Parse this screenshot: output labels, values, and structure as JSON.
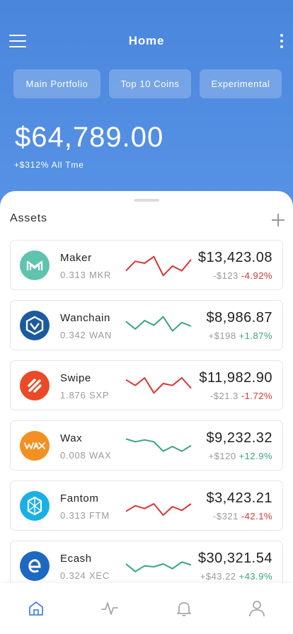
{
  "header": {
    "title": "Home"
  },
  "tabs": [
    {
      "label": "Main Portfolio"
    },
    {
      "label": "Top 10 Coins"
    },
    {
      "label": "Experimental"
    }
  ],
  "portfolio": {
    "balance": "$64,789.00",
    "change": "+$312% All Tme"
  },
  "assets": {
    "title": "Assets",
    "items": [
      {
        "name": "Maker",
        "amount": "0.313 MKR",
        "price": "$13,423.08",
        "change_usd": "-$123",
        "change_pct": "-4.92%",
        "trend": "negative",
        "logo_color": "#5fc3ad",
        "logo_icon": "maker-logo-icon",
        "spark": [
          30,
          40,
          38,
          45,
          25,
          35,
          30,
          42
        ]
      },
      {
        "name": "Wanchain",
        "amount": "0.342 WAN",
        "price": "$8,986.87",
        "change_usd": "+$198",
        "change_pct": "+1.87%",
        "trend": "positive",
        "logo_color": "#1c5aa0",
        "logo_icon": "wanchain-logo-icon",
        "spark": [
          40,
          32,
          41,
          36,
          45,
          30,
          39,
          35
        ]
      },
      {
        "name": "Swipe",
        "amount": "1.876 SXP",
        "price": "$11,982.90",
        "change_usd": "-$21.3",
        "change_pct": "-1.72%",
        "trend": "negative",
        "logo_color": "#ea4a28",
        "logo_icon": "swipe-logo-icon",
        "spark": [
          42,
          36,
          44,
          28,
          38,
          36,
          44,
          33
        ]
      },
      {
        "name": "Wax",
        "amount": "0.008 WAX",
        "price": "$9,232.32",
        "change_usd": "+$120",
        "change_pct": "+12.9%",
        "trend": "positive",
        "logo_color": "#f39022",
        "logo_icon": "wax-logo-icon",
        "spark": [
          43,
          40,
          42,
          40,
          30,
          35,
          30,
          36
        ]
      },
      {
        "name": "Fantom",
        "amount": "0.313 FTM",
        "price": "$3,423.21",
        "change_usd": "-$321",
        "change_pct": "-42.1%",
        "trend": "negative",
        "logo_color": "#1ab0e6",
        "logo_icon": "fantom-logo-icon",
        "spark": [
          30,
          36,
          33,
          38,
          26,
          35,
          31,
          38
        ]
      },
      {
        "name": "Ecash",
        "amount": "0.324 XEC",
        "price": "$30,321.54",
        "change_usd": "+$43.22",
        "change_pct": "+43.9%",
        "trend": "positive",
        "logo_color": "#1d68c1",
        "logo_icon": "ecash-logo-icon",
        "spark": [
          38,
          30,
          36,
          35,
          38,
          33,
          40,
          37
        ]
      }
    ]
  },
  "nav": [
    {
      "icon": "home-icon",
      "active": true
    },
    {
      "icon": "activity-icon",
      "active": false
    },
    {
      "icon": "bell-icon",
      "active": false
    },
    {
      "icon": "profile-icon",
      "active": false
    }
  ],
  "colors": {
    "accent": "#4a86dc",
    "negative": "#d93535",
    "positive": "#3aa57c"
  }
}
